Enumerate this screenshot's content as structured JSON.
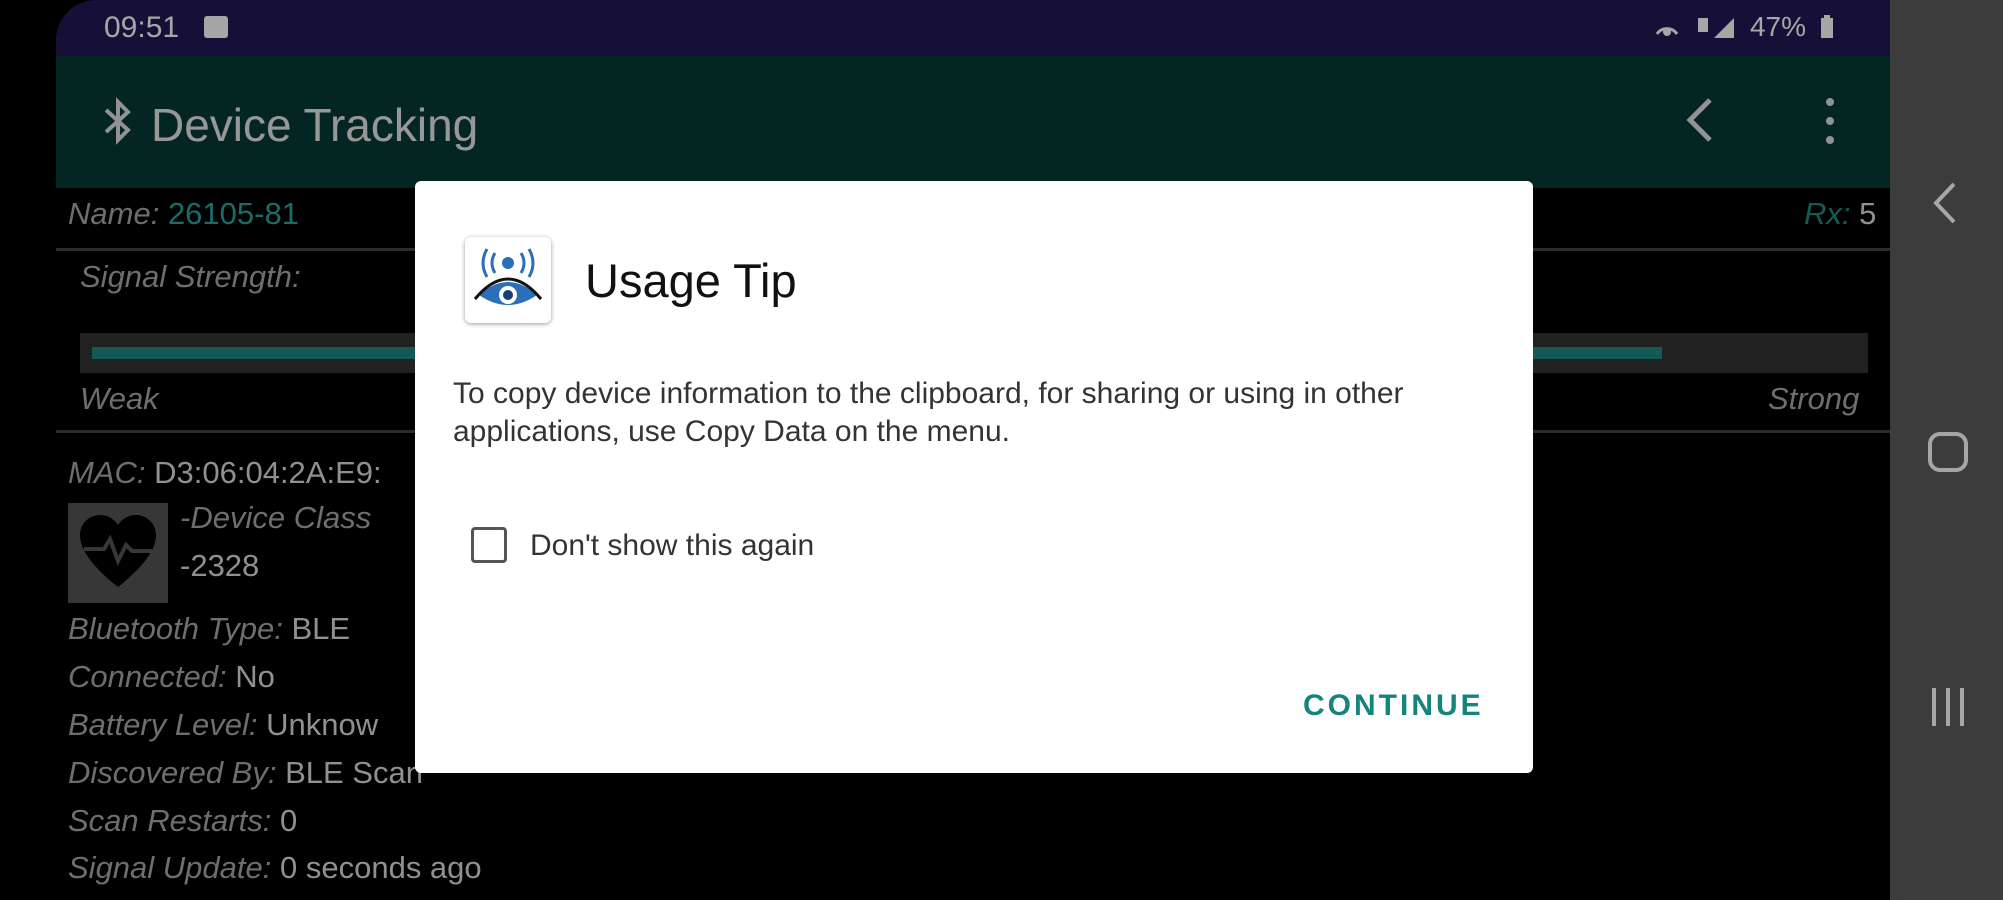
{
  "status_bar": {
    "time": "09:51",
    "battery": "47%"
  },
  "app_bar": {
    "title": "Device Tracking"
  },
  "device": {
    "name_label": "Name:",
    "name_value": "26105-81",
    "rx_label": "Rx:",
    "rx_value": "5",
    "signal_label": "Signal Strength:",
    "weak_label": "Weak",
    "strong_label": "Strong",
    "signal_level": 0.89,
    "mac_label": "MAC:",
    "mac_value": "D3:06:04:2A:E9:",
    "device_class_label": "-Device Class",
    "device_class_value": "-2328",
    "bt_type_label": "Bluetooth Type:",
    "bt_type_value": "BLE",
    "connected_label": "Connected:",
    "connected_value": "No",
    "battery_label": "Battery Level:",
    "battery_value": "Unknow",
    "discovered_label": "Discovered By:",
    "discovered_value": "BLE Scan",
    "restarts_label": "Scan Restarts:",
    "restarts_value": "0",
    "update_label": "Signal Update:",
    "update_value": "0 seconds ago"
  },
  "dialog": {
    "title": "Usage Tip",
    "message": "To copy device information to the clipboard, for sharing or using in other applications, use Copy Data on the menu.",
    "checkbox_label": "Don't show this again",
    "checkbox_checked": false,
    "button": "CONTINUE"
  }
}
